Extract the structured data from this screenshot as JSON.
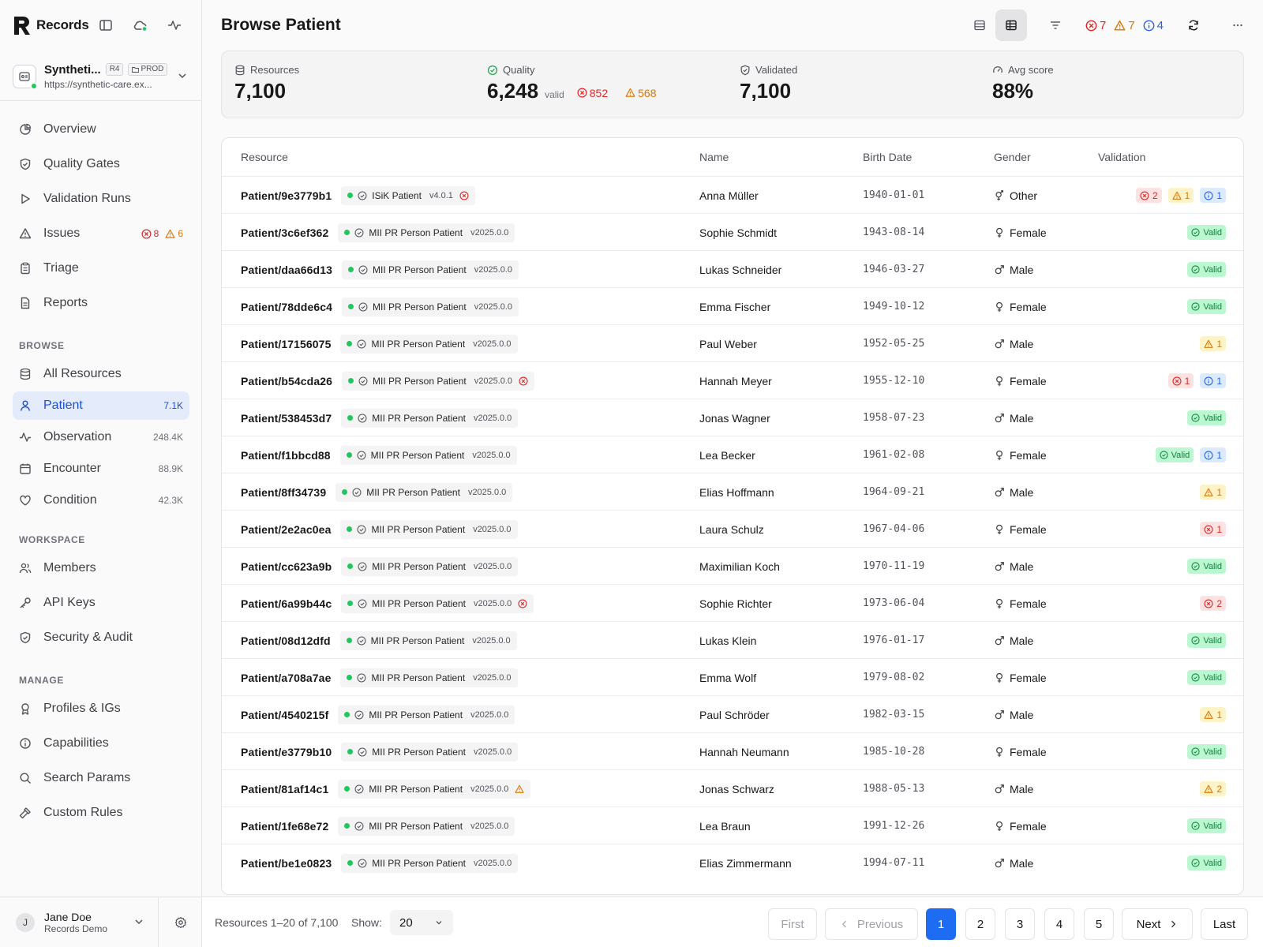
{
  "app": {
    "name": "Records"
  },
  "workspace": {
    "name": "Syntheti...",
    "fhir_version": "R4",
    "env": "PROD",
    "url": "https://synthetic-care.ex..."
  },
  "nav_main": [
    {
      "label": "Overview",
      "icon": "pie-chart-icon"
    },
    {
      "label": "Quality Gates",
      "icon": "shield-icon"
    },
    {
      "label": "Validation Runs",
      "icon": "play-icon"
    },
    {
      "label": "Issues",
      "icon": "warning-triangle-icon"
    },
    {
      "label": "Triage",
      "icon": "clipboard-icon"
    },
    {
      "label": "Reports",
      "icon": "document-icon"
    }
  ],
  "issues_counts": {
    "errors": "8",
    "warnings": "6"
  },
  "sections": {
    "browse": "BROWSE",
    "workspace": "WORKSPACE",
    "manage": "MANAGE"
  },
  "nav_browse": [
    {
      "label": "All Resources",
      "count": "",
      "icon": "database-icon"
    },
    {
      "label": "Patient",
      "count": "7.1K",
      "icon": "user-icon"
    },
    {
      "label": "Observation",
      "count": "248.4K",
      "icon": "activity-icon"
    },
    {
      "label": "Encounter",
      "count": "88.9K",
      "icon": "calendar-icon"
    },
    {
      "label": "Condition",
      "count": "42.3K",
      "icon": "heart-icon"
    }
  ],
  "nav_workspace": [
    {
      "label": "Members",
      "icon": "users-icon"
    },
    {
      "label": "API Keys",
      "icon": "key-icon"
    },
    {
      "label": "Security & Audit",
      "icon": "shield-check-icon"
    }
  ],
  "nav_manage": [
    {
      "label": "Profiles & IGs",
      "icon": "award-icon"
    },
    {
      "label": "Capabilities",
      "icon": "info-circle-icon"
    },
    {
      "label": "Search Params",
      "icon": "search-icon"
    },
    {
      "label": "Custom Rules",
      "icon": "hammer-icon"
    }
  ],
  "user": {
    "initial": "J",
    "name": "Jane Doe",
    "org": "Records Demo"
  },
  "page": {
    "title": "Browse Patient"
  },
  "header_counts": {
    "errors": "7",
    "warnings": "7",
    "info": "4"
  },
  "stats": {
    "resources": {
      "label": "Resources",
      "value": "7,100"
    },
    "quality": {
      "label": "Quality",
      "value": "6,248",
      "sub": "valid",
      "errors": "852",
      "warnings": "568"
    },
    "validated": {
      "label": "Validated",
      "value": "7,100"
    },
    "avg": {
      "label": "Avg score",
      "value": "88%"
    }
  },
  "table": {
    "headers": {
      "resource": "Resource",
      "name": "Name",
      "birth": "Birth Date",
      "gender": "Gender",
      "validation": "Validation"
    },
    "rows": [
      {
        "id": "Patient/9e3779b1",
        "profile": "ISiK Patient",
        "version": "v4.0.1",
        "flag": "error",
        "name": "Anna Müller",
        "birth": "1940-01-01",
        "gender": "Other",
        "gicon": "other",
        "v": [
          {
            "t": "err",
            "n": "2"
          },
          {
            "t": "warn",
            "n": "1"
          },
          {
            "t": "info",
            "n": "1"
          }
        ]
      },
      {
        "id": "Patient/3c6ef362",
        "profile": "MII PR Person Patient",
        "version": "v2025.0.0",
        "flag": "",
        "name": "Sophie Schmidt",
        "birth": "1943-08-14",
        "gender": "Female",
        "gicon": "f",
        "v": [
          {
            "t": "ok",
            "n": "Valid"
          }
        ]
      },
      {
        "id": "Patient/daa66d13",
        "profile": "MII PR Person Patient",
        "version": "v2025.0.0",
        "flag": "",
        "name": "Lukas Schneider",
        "birth": "1946-03-27",
        "gender": "Male",
        "gicon": "m",
        "v": [
          {
            "t": "ok",
            "n": "Valid"
          }
        ]
      },
      {
        "id": "Patient/78dde6c4",
        "profile": "MII PR Person Patient",
        "version": "v2025.0.0",
        "flag": "",
        "name": "Emma Fischer",
        "birth": "1949-10-12",
        "gender": "Female",
        "gicon": "f",
        "v": [
          {
            "t": "ok",
            "n": "Valid"
          }
        ]
      },
      {
        "id": "Patient/17156075",
        "profile": "MII PR Person Patient",
        "version": "v2025.0.0",
        "flag": "",
        "name": "Paul Weber",
        "birth": "1952-05-25",
        "gender": "Male",
        "gicon": "m",
        "v": [
          {
            "t": "warn",
            "n": "1"
          }
        ]
      },
      {
        "id": "Patient/b54cda26",
        "profile": "MII PR Person Patient",
        "version": "v2025.0.0",
        "flag": "error",
        "name": "Hannah Meyer",
        "birth": "1955-12-10",
        "gender": "Female",
        "gicon": "f",
        "v": [
          {
            "t": "err",
            "n": "1"
          },
          {
            "t": "info",
            "n": "1"
          }
        ]
      },
      {
        "id": "Patient/538453d7",
        "profile": "MII PR Person Patient",
        "version": "v2025.0.0",
        "flag": "",
        "name": "Jonas Wagner",
        "birth": "1958-07-23",
        "gender": "Male",
        "gicon": "m",
        "v": [
          {
            "t": "ok",
            "n": "Valid"
          }
        ]
      },
      {
        "id": "Patient/f1bbcd88",
        "profile": "MII PR Person Patient",
        "version": "v2025.0.0",
        "flag": "",
        "name": "Lea Becker",
        "birth": "1961-02-08",
        "gender": "Female",
        "gicon": "f",
        "v": [
          {
            "t": "ok",
            "n": "Valid"
          },
          {
            "t": "info",
            "n": "1"
          }
        ]
      },
      {
        "id": "Patient/8ff34739",
        "profile": "MII PR Person Patient",
        "version": "v2025.0.0",
        "flag": "",
        "name": "Elias Hoffmann",
        "birth": "1964-09-21",
        "gender": "Male",
        "gicon": "m",
        "v": [
          {
            "t": "warn",
            "n": "1"
          }
        ]
      },
      {
        "id": "Patient/2e2ac0ea",
        "profile": "MII PR Person Patient",
        "version": "v2025.0.0",
        "flag": "",
        "name": "Laura Schulz",
        "birth": "1967-04-06",
        "gender": "Female",
        "gicon": "f",
        "v": [
          {
            "t": "err",
            "n": "1"
          }
        ]
      },
      {
        "id": "Patient/cc623a9b",
        "profile": "MII PR Person Patient",
        "version": "v2025.0.0",
        "flag": "",
        "name": "Maximilian Koch",
        "birth": "1970-11-19",
        "gender": "Male",
        "gicon": "m",
        "v": [
          {
            "t": "ok",
            "n": "Valid"
          }
        ]
      },
      {
        "id": "Patient/6a99b44c",
        "profile": "MII PR Person Patient",
        "version": "v2025.0.0",
        "flag": "error",
        "name": "Sophie Richter",
        "birth": "1973-06-04",
        "gender": "Female",
        "gicon": "f",
        "v": [
          {
            "t": "err",
            "n": "2"
          }
        ]
      },
      {
        "id": "Patient/08d12dfd",
        "profile": "MII PR Person Patient",
        "version": "v2025.0.0",
        "flag": "",
        "name": "Lukas Klein",
        "birth": "1976-01-17",
        "gender": "Male",
        "gicon": "m",
        "v": [
          {
            "t": "ok",
            "n": "Valid"
          }
        ]
      },
      {
        "id": "Patient/a708a7ae",
        "profile": "MII PR Person Patient",
        "version": "v2025.0.0",
        "flag": "",
        "name": "Emma Wolf",
        "birth": "1979-08-02",
        "gender": "Female",
        "gicon": "f",
        "v": [
          {
            "t": "ok",
            "n": "Valid"
          }
        ]
      },
      {
        "id": "Patient/4540215f",
        "profile": "MII PR Person Patient",
        "version": "v2025.0.0",
        "flag": "",
        "name": "Paul Schröder",
        "birth": "1982-03-15",
        "gender": "Male",
        "gicon": "m",
        "v": [
          {
            "t": "warn",
            "n": "1"
          }
        ]
      },
      {
        "id": "Patient/e3779b10",
        "profile": "MII PR Person Patient",
        "version": "v2025.0.0",
        "flag": "",
        "name": "Hannah Neumann",
        "birth": "1985-10-28",
        "gender": "Female",
        "gicon": "f",
        "v": [
          {
            "t": "ok",
            "n": "Valid"
          }
        ]
      },
      {
        "id": "Patient/81af14c1",
        "profile": "MII PR Person Patient",
        "version": "v2025.0.0",
        "flag": "warn",
        "name": "Jonas Schwarz",
        "birth": "1988-05-13",
        "gender": "Male",
        "gicon": "m",
        "v": [
          {
            "t": "warn",
            "n": "2"
          }
        ]
      },
      {
        "id": "Patient/1fe68e72",
        "profile": "MII PR Person Patient",
        "version": "v2025.0.0",
        "flag": "",
        "name": "Lea Braun",
        "birth": "1991-12-26",
        "gender": "Female",
        "gicon": "f",
        "v": [
          {
            "t": "ok",
            "n": "Valid"
          }
        ]
      },
      {
        "id": "Patient/be1e0823",
        "profile": "MII PR Person Patient",
        "version": "v2025.0.0",
        "flag": "",
        "name": "Elias Zimmermann",
        "birth": "1994-07-11",
        "gender": "Male",
        "gicon": "m",
        "v": [
          {
            "t": "ok",
            "n": "Valid"
          }
        ]
      }
    ]
  },
  "footer": {
    "range": "Resources 1–20 of 7,100",
    "show_label": "Show:",
    "show_value": "20",
    "pagination": {
      "first": "First",
      "previous": "Previous",
      "pages": [
        "1",
        "2",
        "3",
        "4",
        "5"
      ],
      "current": "1",
      "next": "Next",
      "last": "Last"
    }
  }
}
